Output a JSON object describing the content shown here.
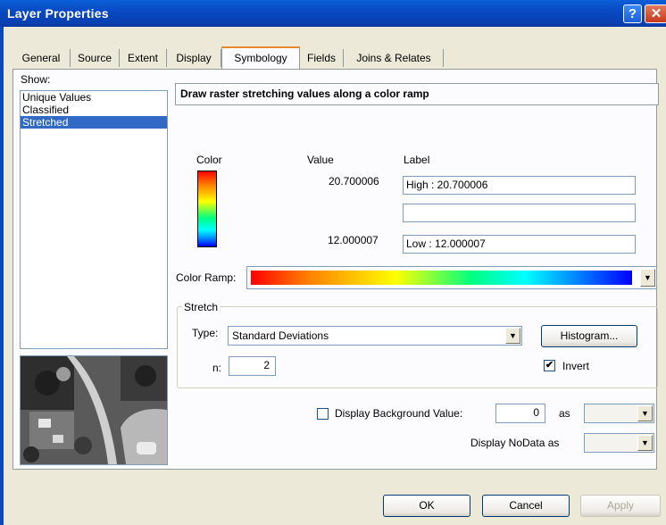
{
  "window": {
    "title": "Layer Properties",
    "help_glyph": "?",
    "close_glyph": "✕"
  },
  "tabs": [
    {
      "label": "General"
    },
    {
      "label": "Source"
    },
    {
      "label": "Extent"
    },
    {
      "label": "Display"
    },
    {
      "label": "Symbology",
      "active": true
    },
    {
      "label": "Fields"
    },
    {
      "label": "Joins & Relates"
    }
  ],
  "show": {
    "label": "Show:",
    "items": [
      "Unique Values",
      "Classified",
      "Stretched"
    ],
    "selected": "Stretched"
  },
  "header": {
    "text": "Draw raster stretching values along a color ramp"
  },
  "columns": {
    "color": "Color",
    "value": "Value",
    "label": "Label"
  },
  "values": {
    "high": "20.700006",
    "low": "12.000007"
  },
  "labels": {
    "high": "High : 20.700006",
    "mid": "",
    "low": "Low : 12.000007"
  },
  "color_ramp": {
    "label": "Color Ramp:"
  },
  "stretch": {
    "title": "Stretch",
    "type_label": "Type:",
    "type_value": "Standard Deviations",
    "n_label": "n:",
    "n_value": "2",
    "histogram_label": "Histogram...",
    "invert_label": "Invert",
    "invert_checked": true
  },
  "background": {
    "label": "Display Background Value:",
    "value": "0",
    "as_label": "as",
    "checked": false
  },
  "nodata": {
    "label": "Display NoData as"
  },
  "buttons": {
    "ok": "OK",
    "cancel": "Cancel",
    "apply": "Apply"
  },
  "check_glyph": "✔",
  "dropdown_glyph": "▼"
}
